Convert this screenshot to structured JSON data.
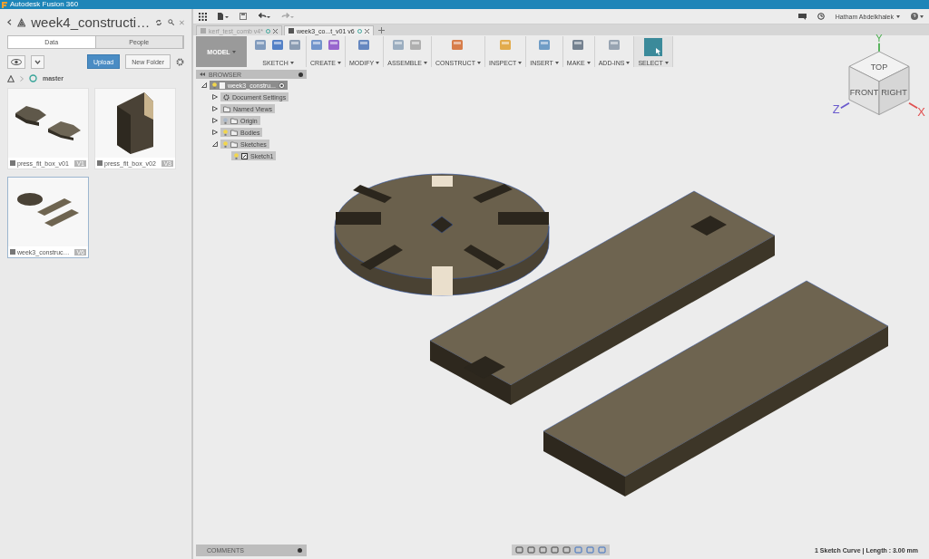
{
  "window": {
    "title": "Autodesk Fusion 360"
  },
  "data_panel": {
    "project_title": "week4_constructi…",
    "tabs": [
      {
        "label": "Data",
        "selected": true
      },
      {
        "label": "People",
        "selected": false
      }
    ],
    "buttons": [
      {
        "label": "Upload",
        "kind": "primary"
      },
      {
        "label": "New Folder",
        "kind": "plain"
      }
    ],
    "breadcrumb": "master",
    "files": [
      {
        "name": "press_fit_box_v01",
        "version": "V1",
        "selected": false,
        "kind": "plates"
      },
      {
        "name": "press_fit_box_v02",
        "version": "V3",
        "selected": false,
        "kind": "box"
      },
      {
        "name": "week3_construc…",
        "version": "V6",
        "selected": true,
        "kind": "parts"
      }
    ]
  },
  "top_bar": {
    "user": "Hatham Abdelkhalek"
  },
  "doc_tabs": [
    {
      "label": "kerf_test_comb v4*",
      "selected": false
    },
    {
      "label": "week3_co...t_v01 v6",
      "selected": true
    }
  ],
  "ribbon": {
    "workspace": "MODEL",
    "groups": [
      {
        "label": "SKETCH"
      },
      {
        "label": "CREATE"
      },
      {
        "label": "MODIFY"
      },
      {
        "label": "ASSEMBLE"
      },
      {
        "label": "CONSTRUCT"
      },
      {
        "label": "INSPECT"
      },
      {
        "label": "INSERT"
      },
      {
        "label": "MAKE"
      },
      {
        "label": "ADD-INS"
      },
      {
        "label": "SELECT"
      }
    ]
  },
  "browser": {
    "title": "BROWSER",
    "tree": [
      {
        "label": "week3_constru...",
        "kind": "component",
        "visible": true,
        "expanded": true,
        "children": [
          {
            "label": "Document Settings",
            "kind": "settings",
            "expanded": false
          },
          {
            "label": "Named Views",
            "kind": "folder",
            "expanded": false
          },
          {
            "label": "Origin",
            "kind": "folder",
            "visible": false,
            "expanded": false
          },
          {
            "label": "Bodies",
            "kind": "folder",
            "visible": true,
            "expanded": false
          },
          {
            "label": "Sketches",
            "kind": "folder",
            "visible": true,
            "expanded": true,
            "children": [
              {
                "label": "Sketch1",
                "kind": "sketch",
                "visible": true
              }
            ]
          }
        ]
      }
    ]
  },
  "viewcube": {
    "faces": [
      "TOP",
      "FRONT",
      "RIGHT"
    ],
    "axes": [
      "Y",
      "Z",
      "X"
    ]
  },
  "comments": {
    "title": "COMMENTS"
  },
  "status": "1 Sketch Curve | Length : 3.00 mm"
}
